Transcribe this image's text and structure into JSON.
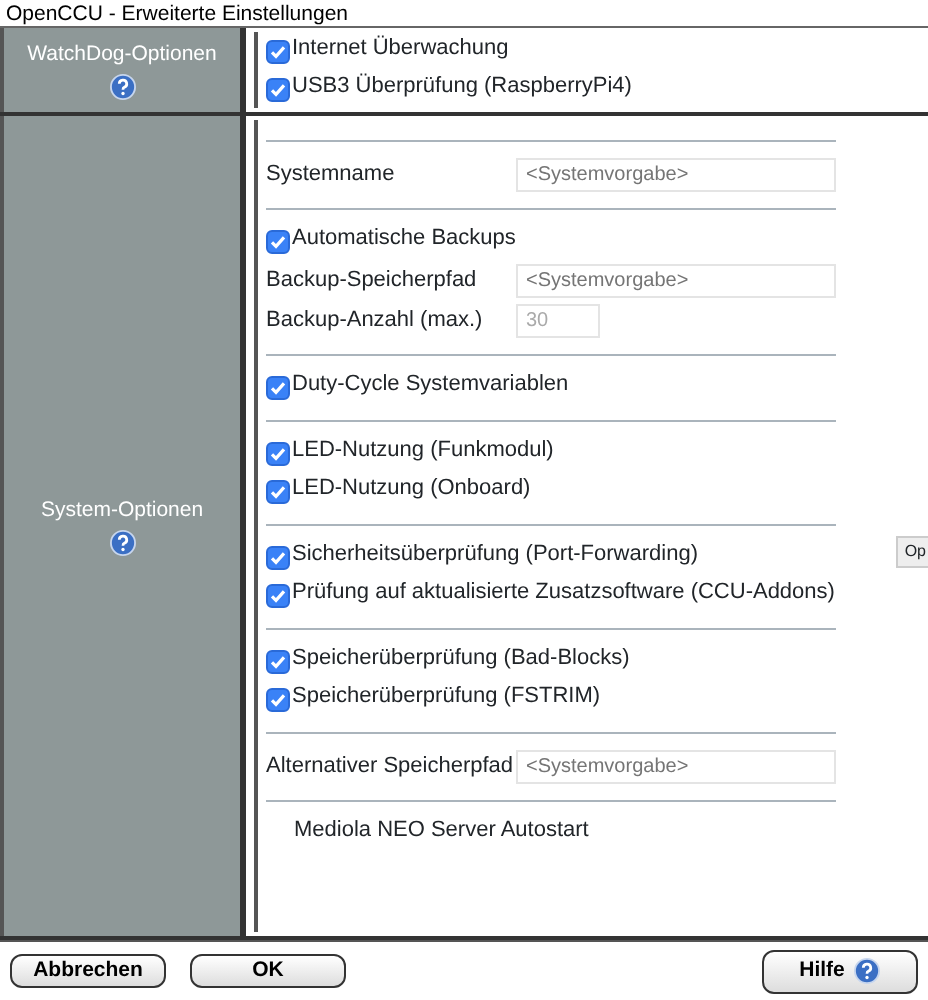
{
  "window": {
    "title": "OpenCCU - Erweiterte Einstellungen"
  },
  "sections": [
    {
      "label": "WatchDog-Optionen",
      "groups": [
        [
          {
            "kind": "checkbox",
            "label": "Internet Überwachung",
            "checked": true
          },
          {
            "kind": "checkbox",
            "label": "USB3 Überprüfung (RaspberryPi4)",
            "checked": true
          }
        ]
      ]
    },
    {
      "label": "System-Optionen",
      "groups": [
        [
          {
            "kind": "field",
            "label": "Systemname",
            "placeholder": "<Systemvorgabe>"
          }
        ],
        [
          {
            "kind": "checkbox",
            "label": "Automatische Backups",
            "checked": true
          },
          {
            "kind": "field",
            "label": "Backup-Speicherpfad",
            "placeholder": "<Systemvorgabe>"
          },
          {
            "kind": "number",
            "label": "Backup-Anzahl (max.)",
            "value": "30"
          }
        ],
        [
          {
            "kind": "checkbox",
            "label": "Duty-Cycle Systemvariablen",
            "checked": true
          }
        ],
        [
          {
            "kind": "checkbox",
            "label": "LED-Nutzung (Funkmodul)",
            "checked": true
          },
          {
            "kind": "checkbox",
            "label": "LED-Nutzung (Onboard)",
            "checked": true
          }
        ],
        [
          {
            "kind": "checkbox",
            "label": "Sicherheitsüberprüfung (Port-Forwarding)",
            "checked": true
          },
          {
            "kind": "checkbox",
            "label": "Prüfung auf aktualisierte Zusatzsoftware (CCU-Addons)",
            "checked": true
          }
        ],
        [
          {
            "kind": "checkbox",
            "label": "Speicherüberprüfung (Bad-Blocks)",
            "checked": true
          },
          {
            "kind": "checkbox",
            "label": "Speicherüberprüfung (FSTRIM)",
            "checked": true
          }
        ],
        [
          {
            "kind": "field",
            "label": "Alternativer Speicherpfad",
            "placeholder": "<Systemvorgabe>"
          }
        ],
        [
          {
            "kind": "label",
            "label": "Mediola NEO Server Autostart"
          }
        ]
      ]
    }
  ],
  "side_tab": "Op",
  "buttons": [
    "Abbrechen",
    "OK"
  ],
  "help_button": "Hilfe"
}
